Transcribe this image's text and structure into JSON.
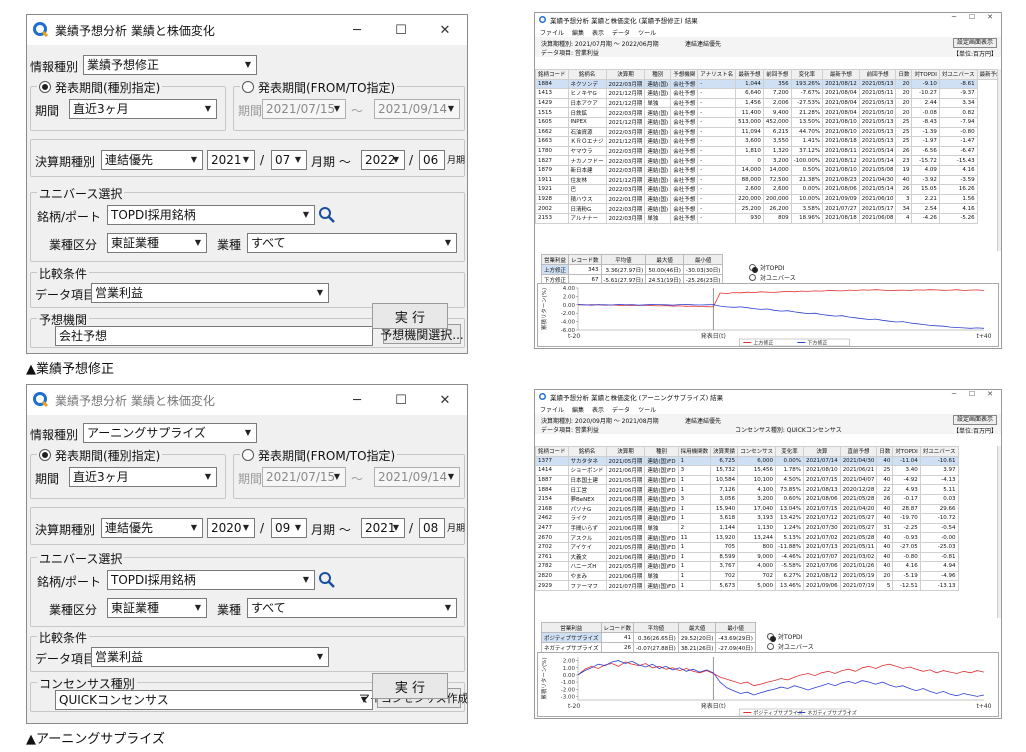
{
  "colors": {
    "red": "#e03030",
    "blue": "#2f3fd0",
    "cursor": "#7a7a7a"
  },
  "dialog1": {
    "title": "業績予想分析 業績と株価変化",
    "info_label": "情報種別",
    "info_value": "業績予想修正",
    "radio_type": "発表期間(種別指定)",
    "radio_range": "発表期間(FROM/TO指定)",
    "period_label": "期間",
    "period_value": "直近3ヶ月",
    "date_label": "期間",
    "date_from": "2021/07/15",
    "tilde": "～",
    "date_to": "2021/09/14",
    "fiscal_label": "決算期種別",
    "fiscal_value": "連結優先",
    "year_from": "2021",
    "slash": "/",
    "month_from": "07",
    "month_word": "月期 ～",
    "year_to": "2022",
    "month_to": "06",
    "month_end": "月期",
    "universe_label": "ユニバース選択",
    "brand_label": "銘柄/ポート",
    "brand_value": "TOPDI採用銘柄",
    "sector_label": "業種区分",
    "sector_value": "東証業種",
    "industry_label": "業種",
    "industry_value": "すべて",
    "compare_label": "比較条件",
    "data_label": "データ項目",
    "data_value": "営業利益",
    "org_label": "予想機関",
    "org_value": "会社予想",
    "org_button": "予想機関選択...",
    "run_button": "実 行"
  },
  "dialog2": {
    "title": "業績予想分析 業績と株価変化",
    "info_label": "情報種別",
    "info_value": "アーニングサプライズ",
    "radio_type": "発表期間(種別指定)",
    "radio_range": "発表期間(FROM/TO指定)",
    "period_label": "期間",
    "period_value": "直近3ヶ月",
    "date_label": "期間",
    "date_from": "2021/07/15",
    "tilde": "～",
    "date_to": "2021/09/14",
    "fiscal_label": "決算期種別",
    "fiscal_value": "連結優先",
    "year_from": "2020",
    "slash": "/",
    "month_from": "09",
    "month_word": "月期 ～",
    "year_to": "2021",
    "month_to": "08",
    "month_end": "月期",
    "universe_label": "ユニバース選択",
    "brand_label": "銘柄/ポート",
    "brand_value": "TOPDI採用銘柄",
    "sector_label": "業種区分",
    "sector_value": "東証業種",
    "industry_label": "業種",
    "industry_value": "すべて",
    "compare_label": "比較条件",
    "data_label": "データ項目",
    "data_value": "営業利益",
    "org_label": "コンセンサス種別",
    "org_value": "QUICKコンセンサス",
    "org_button": "マイコンセンサス作成...",
    "run_button": "実 行"
  },
  "captions": {
    "top": "▲業績予想修正",
    "bottom": "▲アーニングサプライズ"
  },
  "result1": {
    "title": "業績予想分析 業績と株価変化 (業績予想修正) 結果",
    "menu": [
      "ファイル",
      "編集",
      "表示",
      "データ",
      "ツール"
    ],
    "period": "決算期種別: 2021/07月期 ～ 2022/06月期",
    "fiscal": "連結連結優先",
    "data_item": "データ項目: 営業利益",
    "settings_button": "設定画面表示",
    "unit": "【単位:百万円】",
    "headers": [
      "銘柄コード",
      "銘柄名",
      "決算期",
      "種別",
      "予想機関",
      "アナリスト名",
      "最新予想",
      "前回予想",
      "変化率",
      "最新予想",
      "前回予想",
      "日数",
      "対TOPDI",
      "対ユニバース",
      "最新予想",
      "前回予想"
    ],
    "group_headers": {
      "profit": "営業利益",
      "date": "発表日",
      "rate": "発表日前後の株価騰落率",
      "rating": "アナリストレポート"
    },
    "rows": [
      [
        "1884",
        "ネクソンデ",
        "2022/03月期",
        "連結(国)",
        "会社予想",
        "-",
        "1,044",
        "356",
        "193.26%",
        "2021/08/12",
        "2021/05/13",
        "20",
        "-9.10",
        "-8.61"
      ],
      [
        "1413",
        "ヒノキヤG",
        "2021/12月期",
        "連結(国)",
        "会社予想",
        "-",
        "6,640",
        "7,200",
        "-7.67%",
        "2021/08/04",
        "2021/05/11",
        "20",
        "-10.27",
        "-9.37"
      ],
      [
        "1429",
        "日本アクア",
        "2021/12月期",
        "単独",
        "会社予想",
        "-",
        "1,456",
        "2,006",
        "-27.53%",
        "2021/08/04",
        "2021/05/13",
        "20",
        "2.44",
        "3.34"
      ],
      [
        "1515",
        "日鉄鉱",
        "2022/03月期",
        "連結(国)",
        "会社予想",
        "-",
        "11,400",
        "9,400",
        "21.28%",
        "2021/08/04",
        "2021/05/10",
        "20",
        "-0.08",
        "0.82"
      ],
      [
        "1605",
        "INPEX",
        "2021/12月期",
        "連結(国)",
        "会社予想",
        "-",
        "513,000",
        "452,000",
        "13.50%",
        "2021/08/10",
        "2021/05/13",
        "25",
        "-8.43",
        "-7.94"
      ],
      [
        "1662",
        "石油資源",
        "2022/03月期",
        "連結(国)",
        "会社予想",
        "-",
        "11,094",
        "6,215",
        "44.70%",
        "2021/08/10",
        "2021/05/13",
        "25",
        "-1.39",
        "-0.80"
      ],
      [
        "1663",
        "ＫＲＯエナジ",
        "2021/12月期",
        "連結(国)",
        "会社予想",
        "-",
        "3,600",
        "3,550",
        "1.41%",
        "2021/08/18",
        "2021/05/13",
        "25",
        "-1.97",
        "-1.47"
      ],
      [
        "1780",
        "ヤマウラ",
        "2022/03月期",
        "連結(国)",
        "会社予想",
        "-",
        "1,810",
        "1,320",
        "37.12%",
        "2021/08/11",
        "2021/05/14",
        "26",
        "-6.56",
        "-6.47"
      ],
      [
        "1827",
        "ナカノフドー",
        "2022/03月期",
        "連結(国)",
        "会社予想",
        "-",
        "0",
        "3,200",
        "-100.00%",
        "2021/08/12",
        "2021/05/14",
        "23",
        "-15.72",
        "-15.43"
      ],
      [
        "1879",
        "新日本建",
        "2022/03月期",
        "連結(国)",
        "会社予想",
        "-",
        "14,000",
        "14,000",
        "0.50%",
        "2021/08/10",
        "2021/05/08",
        "19",
        "4.09",
        "4.16"
      ],
      [
        "1911",
        "住友林",
        "2021/12月期",
        "連結(国)",
        "会社予想",
        "-",
        "88,000",
        "72,500",
        "21.38%",
        "2021/08/23",
        "2021/04/30",
        "40",
        "-3.92",
        "-3.59"
      ],
      [
        "1921",
        "巴",
        "2022/03月期",
        "連結(国)",
        "会社予想",
        "-",
        "2,600",
        "2,600",
        "0.00%",
        "2021/08/06",
        "2021/05/14",
        "26",
        "15.05",
        "16.26"
      ],
      [
        "1928",
        "積ハウス",
        "2022/01月期",
        "連結(国)",
        "会社予想",
        "-",
        "220,000",
        "200,000",
        "10.00%",
        "2021/09/09",
        "2021/06/10",
        "3",
        "2.21",
        "1.56"
      ],
      [
        "2002",
        "日清粉G",
        "2022/03月期",
        "連結(国)",
        "会社予想",
        "-",
        "25,200",
        "26,200",
        "3.58%",
        "2021/07/27",
        "2021/05/17",
        "34",
        "2.54",
        "4.16"
      ],
      [
        "2153",
        "アルナナー",
        "2022/03月期",
        "単独",
        "会社予想",
        "-",
        "930",
        "809",
        "18.96%",
        "2021/08/18",
        "2021/06/08",
        "4",
        "-4.26",
        "-5.26"
      ]
    ],
    "stats_headers": [
      "営業利益",
      "レコード数",
      "平均値",
      "最大値",
      "最小値"
    ],
    "stats": [
      [
        "上方修正",
        "343",
        "3.36(27.97日)",
        "50.00(46日)",
        "-30.03(30日)"
      ],
      [
        "下方修正",
        "67",
        "-5.61(27.97日)",
        "24.51(19日)",
        "-25.26(23日)"
      ]
    ],
    "opt1": "対TOPDI",
    "opt2": "対ユニバース",
    "ylabel": "累積リターン(%)",
    "yticks": [
      "4.00",
      "2.00",
      "0.00",
      "-2.00",
      "-4.00",
      "-6.00"
    ],
    "x_left": "t-20",
    "x_mid": "発表日(t)",
    "x_right": "t+40",
    "legend": [
      "上方修正",
      "下方修正"
    ]
  },
  "result2": {
    "title": "業績予想分析 業績と株価変化 (アーニングサプライズ) 結果",
    "menu": [
      "ファイル",
      "編集",
      "表示",
      "データ",
      "ツール"
    ],
    "period": "決算期種別: 2020/09月期 ～ 2021/08月期",
    "fiscal": "連結連結優先",
    "data_item": "データ項目: 営業利益",
    "consensus": "コンセンサス種別: QUICKコンセンサス",
    "settings_button": "設定画面表示",
    "unit": "【単位:百万円】",
    "headers": [
      "銘柄コード",
      "銘柄名",
      "決算期",
      "種別",
      "採用機関数",
      "決算実績",
      "コンセンサス",
      "変化率",
      "決算",
      "直前予想",
      "日数",
      "対TOPDI",
      "対ユニバース"
    ],
    "group_headers": {
      "profit": "営業利益",
      "date": "発表日",
      "rate": "発表日前後の株価騰落率"
    },
    "rows": [
      [
        "1377",
        "サカタタネ",
        "2021/05月期",
        "連結(国)FD",
        "1",
        "6,725",
        "6,000",
        "0.00%",
        "2021/07/14",
        "2021/04/30",
        "40",
        "-11.04",
        "-10.61"
      ],
      [
        "1414",
        "ショーボンド",
        "2021/06月期",
        "連結(国)FD",
        "3",
        "15,732",
        "15,456",
        "1.78%",
        "2021/08/10",
        "2021/06/21",
        "25",
        "3.40",
        "3.97"
      ],
      [
        "1887",
        "日本国土建",
        "2021/05月期",
        "連結(国)FD",
        "1",
        "10,584",
        "10,100",
        "4.50%",
        "2021/07/15",
        "2021/04/07",
        "40",
        "-4.92",
        "-4.13"
      ],
      [
        "1884",
        "日工営",
        "2021/06月期",
        "連結(国)FD",
        "1",
        "7,126",
        "4,100",
        "73.85%",
        "2021/08/13",
        "2020/12/28",
        "22",
        "4.93",
        "5.11"
      ],
      [
        "2154",
        "夢BeNEX",
        "2021/06月期",
        "連結(国)FD",
        "3",
        "3,056",
        "3,200",
        "0.60%",
        "2021/08/06",
        "2021/05/28",
        "26",
        "-0.17",
        "0.03"
      ],
      [
        "2168",
        "パソナG",
        "2021/05月期",
        "連結(国)FD",
        "1",
        "15,940",
        "17,040",
        "13.04%",
        "2021/07/15",
        "2021/04/20",
        "40",
        "28.87",
        "29.66"
      ],
      [
        "2462",
        "ライク",
        "2021/05月期",
        "連結(国)FD",
        "1",
        "3,618",
        "3,193",
        "13.42%",
        "2021/07/12",
        "2021/05/27",
        "40",
        "-19.70",
        "-10.72"
      ],
      [
        "2477",
        "手間いらず",
        "2021/06月期",
        "単独",
        "2",
        "1,144",
        "1,130",
        "1.24%",
        "2021/07/30",
        "2021/05/27",
        "31",
        "-2.25",
        "-0.54"
      ],
      [
        "2670",
        "アスクル",
        "2021/05月期",
        "連結(国)FD",
        "11",
        "13,920",
        "13,244",
        "5.13%",
        "2021/07/02",
        "2021/05/28",
        "40",
        "-0.93",
        "-0.00"
      ],
      [
        "2702",
        "アイケイ",
        "2021/05月期",
        "連結(国)FD",
        "1",
        "705",
        "800",
        "-11.88%",
        "2021/07/13",
        "2021/05/11",
        "40",
        "-27.05",
        "-25.03"
      ],
      [
        "2761",
        "大義文",
        "2021/06月期",
        "連結(国)FD",
        "1",
        "8,599",
        "9,000",
        "-4.46%",
        "2021/07/07",
        "2021/03/02",
        "40",
        "-0.80",
        "-0.81"
      ],
      [
        "2782",
        "ハニーズH",
        "2021/05月期",
        "連結(国)FD",
        "1",
        "3,767",
        "4,000",
        "-5.58%",
        "2021/07/06",
        "2021/01/26",
        "40",
        "4.16",
        "4.94"
      ],
      [
        "2820",
        "やまみ",
        "2021/06月期",
        "単独",
        "1",
        "702",
        "702",
        "6.27%",
        "2021/08/12",
        "2021/05/19",
        "20",
        "-5.19",
        "-4.96"
      ],
      [
        "2929",
        "ファーマフ",
        "2021/07月期",
        "連結(国)FD",
        "1",
        "5,673",
        "5,000",
        "13.46%",
        "2021/09/06",
        "2021/07/19",
        "5",
        "-12.51",
        "-13.13"
      ]
    ],
    "stats_headers": [
      "営業利益",
      "レコード数",
      "平均値",
      "最大値",
      "最小値"
    ],
    "stats": [
      [
        "ポジティブサプライズ",
        "41",
        "0.36(26.65日)",
        "29.52(20日)",
        "-43.69(29日)"
      ],
      [
        "ネガティブサプライズ",
        "26",
        "-0.07(27.88日)",
        "38.21(26日)",
        "-27.09(40日)"
      ]
    ],
    "opt1": "対TOPDI",
    "opt2": "対ユニバース",
    "ylabel": "累積リターン(%)",
    "yticks": [
      "2.00",
      "1.00",
      "0.00",
      "-1.00",
      "-2.00",
      "-3.00"
    ],
    "x_left": "t-20",
    "x_mid": "発表日(t)",
    "x_right": "t+40",
    "legend": [
      "ポジティブサプライズ",
      "ネガティブサプライズ"
    ]
  },
  "chart_data": [
    {
      "type": "line",
      "ylabel": "累積リターン(%)",
      "xlabel": "発表日(t)",
      "x_ticks": [
        "t-20",
        "t+40"
      ],
      "ylim": [
        -6,
        4
      ],
      "series": [
        {
          "name": "上方修正",
          "color": "#e03030",
          "values": [
            0.0,
            -0.05,
            0.05,
            0.0,
            -0.1,
            -0.05,
            -0.15,
            -0.1,
            -0.2,
            -0.15,
            -0.1,
            -0.2,
            -0.25,
            -0.2,
            -0.3,
            -0.25,
            -0.35,
            -0.3,
            -0.4,
            -0.45,
            -0.5,
            2.8,
            2.7,
            2.9,
            2.85,
            3.0,
            2.9,
            3.1,
            3.0,
            2.95,
            3.1,
            3.2,
            3.1,
            3.25,
            3.2,
            3.3,
            3.25,
            3.4,
            3.35,
            3.3,
            3.5,
            3.4,
            3.55,
            3.5,
            3.6,
            3.5,
            3.4,
            3.45,
            3.5,
            3.4,
            3.55,
            3.5,
            3.6,
            3.55,
            3.45,
            3.5,
            3.6,
            3.4,
            3.5,
            3.55,
            3.4
          ]
        },
        {
          "name": "下方修正",
          "color": "#2f3fd0",
          "values": [
            0.1,
            0.0,
            -0.1,
            0.05,
            0.0,
            -0.05,
            0.1,
            0.0,
            0.05,
            -0.1,
            0.0,
            0.1,
            0.05,
            0.0,
            -0.1,
            0.05,
            0.1,
            0.0,
            -0.05,
            0.0,
            0.05,
            -0.3,
            -0.5,
            -0.6,
            -0.5,
            -0.7,
            -0.9,
            -1.1,
            -1.0,
            -1.3,
            -1.5,
            -1.4,
            -1.7,
            -1.9,
            -2.1,
            -2.0,
            -2.3,
            -2.5,
            -2.7,
            -2.6,
            -2.9,
            -3.1,
            -3.3,
            -3.5,
            -3.4,
            -3.7,
            -3.9,
            -4.1,
            -4.0,
            -4.3,
            -4.5,
            -4.7,
            -4.9,
            -5.0,
            -5.1,
            -5.3,
            -5.4,
            -5.5,
            -5.6,
            -5.5,
            -5.6
          ]
        }
      ]
    },
    {
      "type": "line",
      "ylabel": "累積リターン(%)",
      "xlabel": "発表日(t)",
      "x_ticks": [
        "t-20",
        "t+40"
      ],
      "ylim": [
        -3.5,
        2.5
      ],
      "series": [
        {
          "name": "ポジティブサプライズ",
          "color": "#e03030",
          "values": [
            0.0,
            0.8,
            1.2,
            0.9,
            1.4,
            1.6,
            1.2,
            1.8,
            1.5,
            1.3,
            1.6,
            1.0,
            1.2,
            0.8,
            1.0,
            0.6,
            0.9,
            0.5,
            0.3,
            0.6,
            0.2,
            -0.3,
            -0.6,
            -0.9,
            -1.2,
            -1.0,
            -1.5,
            -1.3,
            -1.0,
            -0.8,
            -0.5,
            -0.7,
            -0.3,
            0.0,
            0.2,
            -0.1,
            0.3,
            0.5,
            0.2,
            0.6,
            0.8,
            0.5,
            1.0,
            1.2,
            0.9,
            1.3,
            1.5,
            1.2,
            0.9,
            1.1,
            0.8,
            0.5,
            0.7,
            0.3,
            0.6,
            0.4,
            0.2,
            0.5,
            0.3,
            0.6,
            0.4
          ]
        },
        {
          "name": "ネガティブサプライズ",
          "color": "#2f3fd0",
          "values": [
            0.0,
            0.6,
            1.0,
            1.5,
            1.3,
            1.8,
            2.0,
            1.6,
            1.9,
            1.4,
            1.1,
            1.5,
            0.9,
            1.2,
            0.7,
            1.0,
            0.5,
            0.8,
            0.4,
            0.7,
            0.3,
            -1.0,
            -1.8,
            -2.2,
            -2.6,
            -2.4,
            -2.8,
            -2.5,
            -2.2,
            -2.0,
            -1.7,
            -1.9,
            -1.5,
            -1.8,
            -2.1,
            -1.8,
            -1.5,
            -1.2,
            -1.5,
            -1.1,
            -0.9,
            -1.2,
            -0.8,
            -1.0,
            -1.3,
            -1.0,
            -1.4,
            -1.7,
            -1.5,
            -1.9,
            -2.2,
            -1.9,
            -2.3,
            -2.6,
            -2.3,
            -2.7,
            -2.9,
            -2.6,
            -2.8,
            -3.0,
            -2.8
          ]
        }
      ]
    }
  ]
}
